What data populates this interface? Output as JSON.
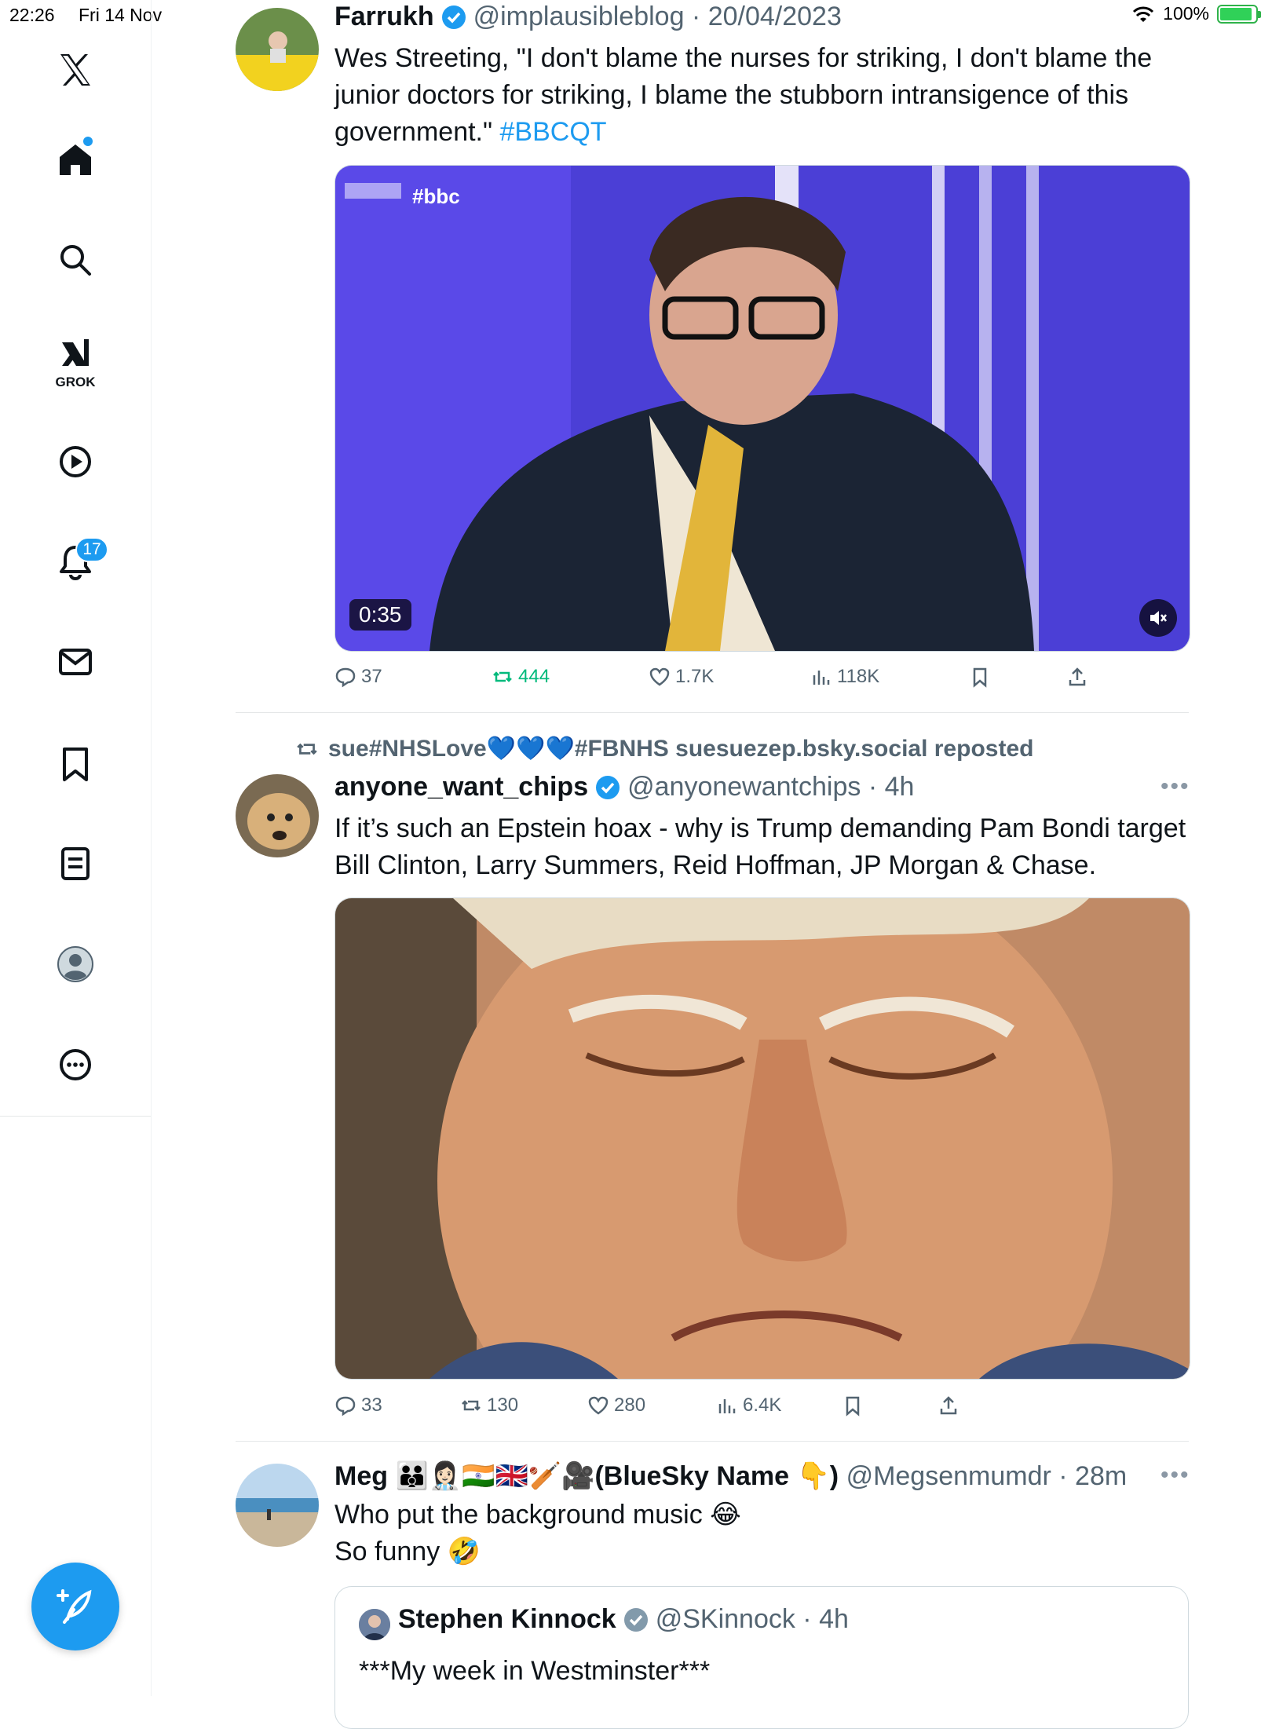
{
  "status_bar": {
    "time": "22:26",
    "date": "Fri 14 Nov",
    "battery": "100%"
  },
  "sidebar": {
    "items": [
      {
        "name": "x-logo-icon"
      },
      {
        "name": "home-icon"
      },
      {
        "name": "search-icon"
      },
      {
        "name": "grok-icon",
        "label": "GROK"
      },
      {
        "name": "video-icon"
      },
      {
        "name": "notifications-icon",
        "badge": "17"
      },
      {
        "name": "messages-icon"
      },
      {
        "name": "bookmarks-icon"
      },
      {
        "name": "lists-icon"
      },
      {
        "name": "profile-icon"
      },
      {
        "name": "more-icon"
      }
    ]
  },
  "tweets": [
    {
      "name": "Farrukh",
      "handle": "@implausibleblog",
      "time": "20/04/2023",
      "text_main": "Wes Streeting, \"I don't blame the nurses for striking, I don't blame the junior doctors for striking, I blame the stubborn intransigence of this government.\"",
      "hashtag": "#BBCQT",
      "video_duration": "0:35",
      "video_watermark": "#bbc",
      "stats": {
        "replies": "37",
        "reposts": "444",
        "likes": "1.7K",
        "views": "118K"
      }
    },
    {
      "repost_by": "sue#NHSLove💙💙💙#FBNHS suesuezep.bsky.social reposted",
      "name": "anyone_want_chips",
      "handle": "@anyonewantchips",
      "time": "4h",
      "text": "If it’s such an Epstein hoax - why is Trump demanding Pam Bondi target Bill Clinton, Larry Summers, Reid Hoffman, JP Morgan & Chase.",
      "stats": {
        "replies": "33",
        "reposts": "130",
        "likes": "280",
        "views": "6.4K"
      }
    },
    {
      "name": "Meg 👪👩🏻‍⚕️🇮🇳🇬🇧🏏🎥(BlueSky Name 👇)",
      "handle": "@Megsenmumdr",
      "time": "28m",
      "text_line1": "Who put the background music 😂",
      "text_line2": "So funny 🤣",
      "quote": {
        "name": "Stephen Kinnock",
        "handle": "@SKinnock",
        "time": "4h",
        "text": "***My week in Westminster***"
      }
    }
  ],
  "colors": {
    "accent": "#1d9bf0",
    "repost": "#00ba7c",
    "muted": "#536471"
  }
}
